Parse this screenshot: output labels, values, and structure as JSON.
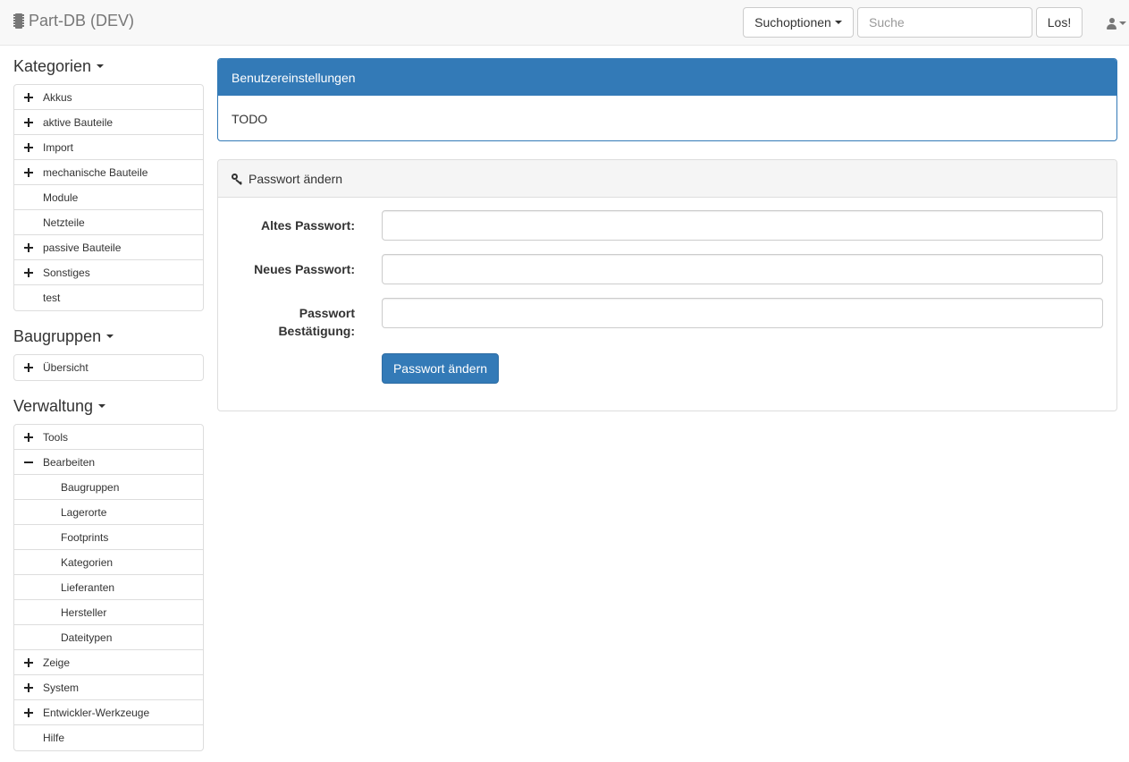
{
  "navbar": {
    "brand": "Part-DB (DEV)",
    "search_options_label": "Suchoptionen",
    "search_placeholder": "Suche",
    "search_value": "",
    "go_label": "Los!"
  },
  "sidebar": {
    "categories": {
      "heading": "Kategorien",
      "items": [
        {
          "label": "Akkus",
          "expander": "plus"
        },
        {
          "label": "aktive Bauteile",
          "expander": "plus"
        },
        {
          "label": "Import",
          "expander": "plus"
        },
        {
          "label": "mechanische Bauteile",
          "expander": "plus"
        },
        {
          "label": "Module",
          "expander": "none"
        },
        {
          "label": "Netzteile",
          "expander": "none"
        },
        {
          "label": "passive Bauteile",
          "expander": "plus"
        },
        {
          "label": "Sonstiges",
          "expander": "plus"
        },
        {
          "label": "test",
          "expander": "none"
        }
      ]
    },
    "assemblies": {
      "heading": "Baugruppen",
      "items": [
        {
          "label": "Übersicht",
          "expander": "plus"
        }
      ]
    },
    "administration": {
      "heading": "Verwaltung",
      "items": [
        {
          "label": "Tools",
          "expander": "plus"
        },
        {
          "label": "Bearbeiten",
          "expander": "minus"
        },
        {
          "label": "Baugruppen",
          "expander": "child"
        },
        {
          "label": "Lagerorte",
          "expander": "child"
        },
        {
          "label": "Footprints",
          "expander": "child"
        },
        {
          "label": "Kategorien",
          "expander": "child"
        },
        {
          "label": "Lieferanten",
          "expander": "child"
        },
        {
          "label": "Hersteller",
          "expander": "child"
        },
        {
          "label": "Dateitypen",
          "expander": "child"
        },
        {
          "label": "Zeige",
          "expander": "plus"
        },
        {
          "label": "System",
          "expander": "plus"
        },
        {
          "label": "Entwickler-Werkzeuge",
          "expander": "plus"
        },
        {
          "label": "Hilfe",
          "expander": "none"
        }
      ]
    }
  },
  "main": {
    "settings_panel": {
      "title": "Benutzereinstellungen",
      "body": "TODO"
    },
    "password_panel": {
      "title": "Passwort ändern",
      "old_password_label": "Altes Passwort:",
      "new_password_label": "Neues Passwort:",
      "confirm_label_line1": "Passwort",
      "confirm_label_line2": "Bestätigung:",
      "old_password_value": "",
      "new_password_value": "",
      "confirm_value": "",
      "submit_label": "Passwort ändern"
    }
  },
  "colors": {
    "primary": "#337ab7",
    "navbar_bg": "#f8f8f8",
    "border": "#dddddd"
  }
}
